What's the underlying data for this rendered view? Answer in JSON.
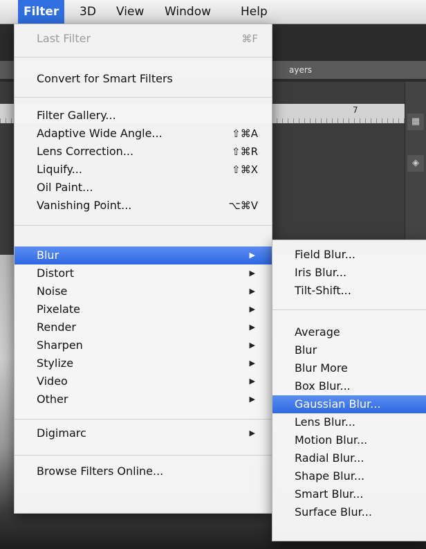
{
  "background": {
    "options_text": "ayers",
    "ruler_number": "7"
  },
  "menubar": {
    "items": [
      {
        "label": "Filter",
        "active": true
      },
      {
        "label": "3D"
      },
      {
        "label": "View"
      },
      {
        "label": "Window"
      },
      {
        "label": "Help"
      }
    ]
  },
  "filter_menu": {
    "last_filter": {
      "label": "Last Filter",
      "shortcut": "⌘F"
    },
    "convert_smart": {
      "label": "Convert for Smart Filters"
    },
    "filter_gallery": {
      "label": "Filter Gallery..."
    },
    "adaptive_wide_angle": {
      "label": "Adaptive Wide Angle...",
      "shortcut": "⇧⌘A"
    },
    "lens_correction": {
      "label": "Lens Correction...",
      "shortcut": "⇧⌘R"
    },
    "liquify": {
      "label": "Liquify...",
      "shortcut": "⇧⌘X"
    },
    "oil_paint": {
      "label": "Oil Paint..."
    },
    "vanishing_point": {
      "label": "Vanishing Point...",
      "shortcut": "⌥⌘V"
    },
    "blur": {
      "label": "Blur"
    },
    "distort": {
      "label": "Distort"
    },
    "noise": {
      "label": "Noise"
    },
    "pixelate": {
      "label": "Pixelate"
    },
    "render": {
      "label": "Render"
    },
    "sharpen": {
      "label": "Sharpen"
    },
    "stylize": {
      "label": "Stylize"
    },
    "video": {
      "label": "Video"
    },
    "other": {
      "label": "Other"
    },
    "digimarc": {
      "label": "Digimarc"
    },
    "browse_online": {
      "label": "Browse Filters Online..."
    },
    "submenu_arrow": "▶"
  },
  "blur_submenu": {
    "field_blur": "Field Blur...",
    "iris_blur": "Iris Blur...",
    "tilt_shift": "Tilt-Shift...",
    "average": "Average",
    "blur": "Blur",
    "blur_more": "Blur More",
    "box_blur": "Box Blur...",
    "gaussian_blur": "Gaussian Blur...",
    "lens_blur": "Lens Blur...",
    "motion_blur": "Motion Blur...",
    "radial_blur": "Radial Blur...",
    "shape_blur": "Shape Blur...",
    "smart_blur": "Smart Blur...",
    "surface_blur": "Surface Blur..."
  },
  "colors": {
    "highlight": "#2e69e3",
    "menubar_active": "#2f6fe0",
    "disabled_text": "#9b9b9b"
  }
}
